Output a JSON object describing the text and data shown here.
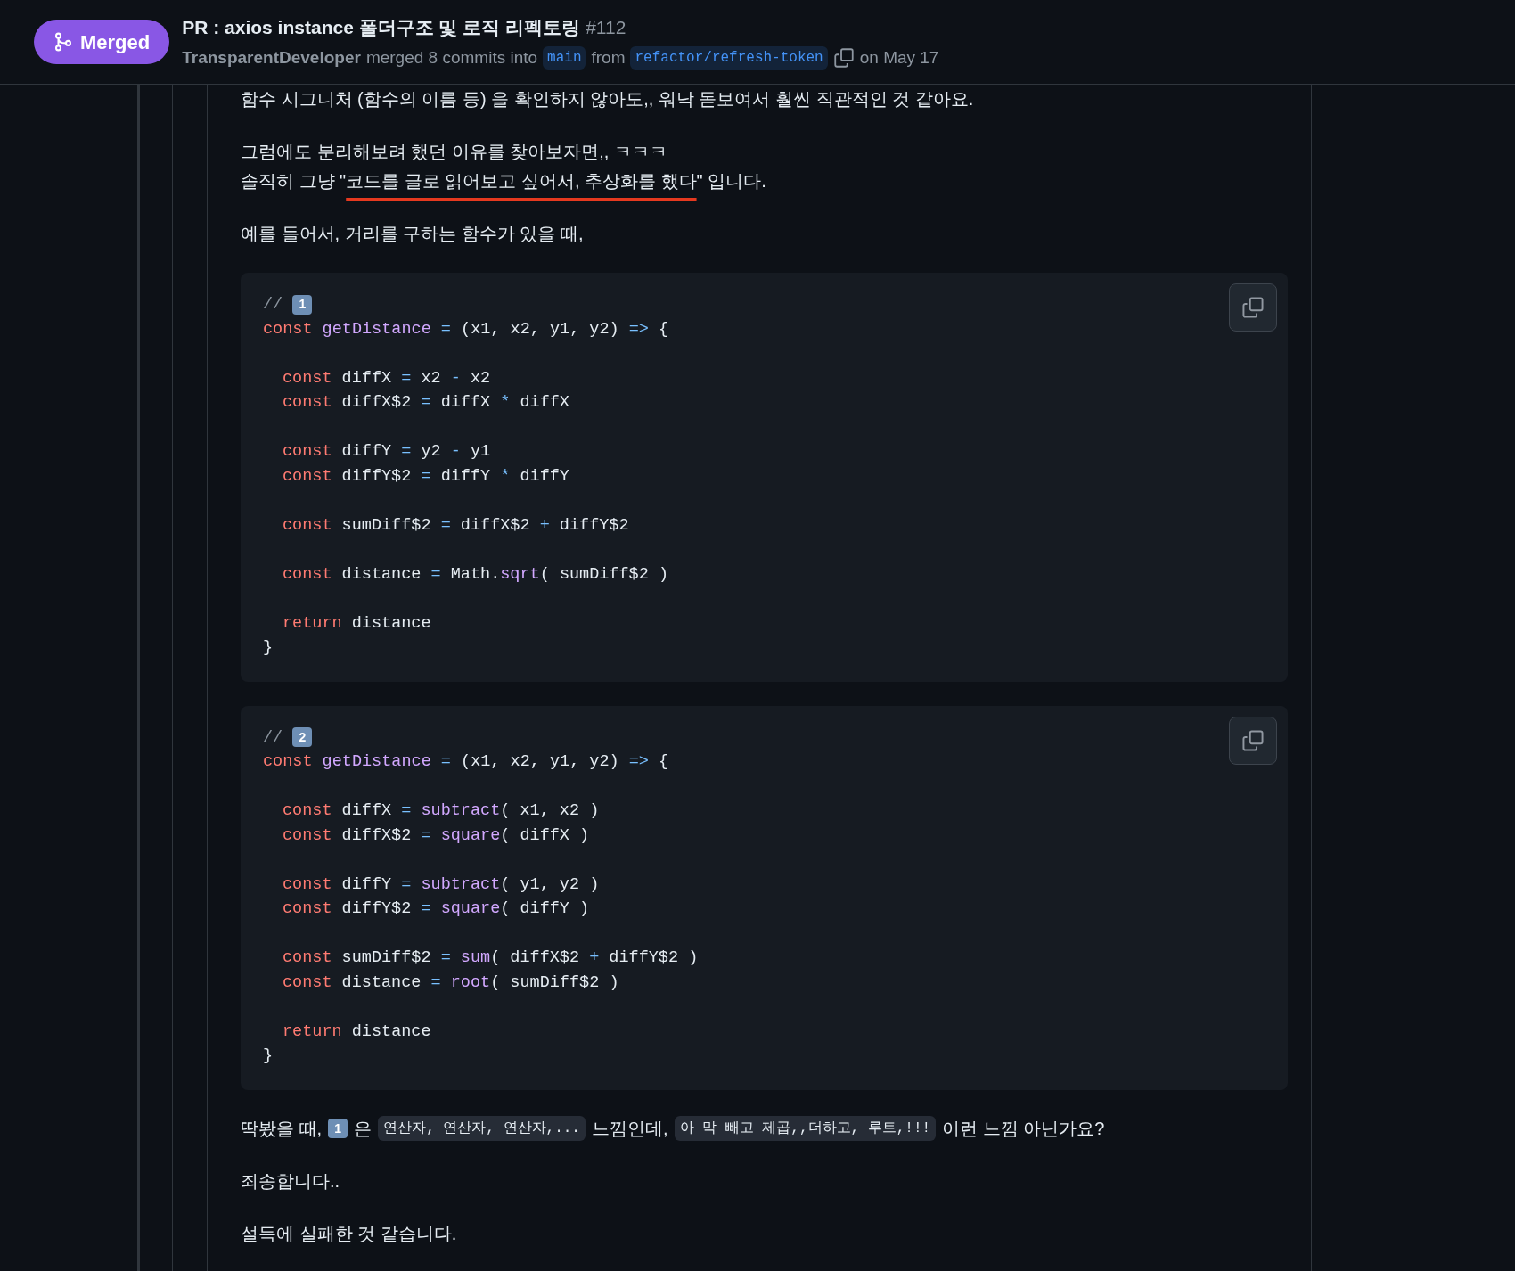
{
  "header": {
    "state_badge": "Merged",
    "title": "PR : axios instance 폴더구조 및 로직 리펙토링",
    "number": "#112",
    "author": "TransparentDeveloper",
    "action": "merged 8 commits into",
    "base_branch": "main",
    "from_word": "from",
    "head_branch": "refactor/refresh-token",
    "date": "on May 17"
  },
  "blocks": [
    {
      "kind": "paragraph",
      "lines": [
        [
          {
            "kind": "text",
            "text": "함수 시그니처 (함수의 이름 등) 을 확인하지 않아도,, 워낙 돋보여서 훨씬 직관적인 것 같아요."
          }
        ]
      ]
    },
    {
      "kind": "paragraph",
      "lines": [
        [
          {
            "kind": "text",
            "text": "그럼에도 분리해보려 했던 이유를 찾아보자면,, ㅋㅋㅋ"
          }
        ],
        [
          {
            "kind": "text",
            "text": "솔직히 그냥 \"**코드를 글로 읽어보고 싶어서, 추상화를 했다**\" 입니다.",
            "marked": true
          }
        ]
      ]
    },
    {
      "kind": "paragraph",
      "lines": [
        [
          {
            "kind": "text",
            "text": "예를 들어서, 거리를 구하는 함수가 있을 때,"
          }
        ]
      ]
    },
    {
      "kind": "code",
      "head": [
        {
          "tokens": [
            {
              "kind": "comment",
              "text": "//"
            },
            {
              "kind": "keycap",
              "text": "1"
            }
          ]
        },
        {
          "tokens": [
            {
              "kind": "keyword",
              "text": "const"
            },
            {
              "kind": "func",
              "text": "getDistance"
            },
            {
              "kind": "op",
              "text": "="
            },
            {
              "kind": "plain",
              "text": "(x1, x2, y1, y2)"
            },
            {
              "kind": "op",
              "text": "=>"
            },
            {
              "kind": "plain",
              "text": "{"
            }
          ]
        }
      ],
      "body": [
        [
          {
            "tokens": [
              {
                "kind": "keyword",
                "text": "const"
              },
              {
                "kind": "plain",
                "text": "diffX"
              },
              {
                "kind": "op",
                "text": "="
              },
              {
                "kind": "plain",
                "text": "x2"
              },
              {
                "kind": "op",
                "text": "-"
              },
              {
                "kind": "plain",
                "text": "x2"
              }
            ]
          },
          {
            "tokens": [
              {
                "kind": "keyword",
                "text": "const"
              },
              {
                "kind": "plain",
                "text": "diffX$2"
              },
              {
                "kind": "op",
                "text": "="
              },
              {
                "kind": "plain",
                "text": "diffX"
              },
              {
                "kind": "op",
                "text": "*"
              },
              {
                "kind": "plain",
                "text": "diffX"
              }
            ]
          }
        ],
        [
          {
            "tokens": [
              {
                "kind": "keyword",
                "text": "const"
              },
              {
                "kind": "plain",
                "text": "diffY"
              },
              {
                "kind": "op",
                "text": "="
              },
              {
                "kind": "plain",
                "text": "y2"
              },
              {
                "kind": "op",
                "text": "-"
              },
              {
                "kind": "plain",
                "text": "y1"
              }
            ]
          },
          {
            "tokens": [
              {
                "kind": "keyword",
                "text": "const"
              },
              {
                "kind": "plain",
                "text": "diffY$2"
              },
              {
                "kind": "op",
                "text": "="
              },
              {
                "kind": "plain",
                "text": "diffY"
              },
              {
                "kind": "op",
                "text": "*"
              },
              {
                "kind": "plain",
                "text": "diffY"
              }
            ]
          }
        ],
        [
          {
            "tokens": [
              {
                "kind": "keyword",
                "text": "const"
              },
              {
                "kind": "plain",
                "text": "sumDiff$2"
              },
              {
                "kind": "op",
                "text": "="
              },
              {
                "kind": "plain",
                "text": "diffX$2"
              },
              {
                "kind": "op",
                "text": "+"
              },
              {
                "kind": "plain",
                "text": "diffY$2"
              }
            ]
          }
        ],
        [
          {
            "tokens": [
              {
                "kind": "keyword",
                "text": "const"
              },
              {
                "kind": "plain",
                "text": "distance"
              },
              {
                "kind": "op",
                "text": "="
              },
              {
                "kind": "plain",
                "text": "Math."
              },
              {
                "kind": "func",
                "text": "sqrt"
              },
              {
                "kind": "plain",
                "text": "( sumDiff$2 )"
              }
            ]
          }
        ],
        [
          {
            "tokens": [
              {
                "kind": "keyword",
                "text": "return"
              },
              {
                "kind": "plain",
                "text": "distance"
              }
            ]
          }
        ]
      ],
      "tail": [
        {
          "tokens": [
            {
              "kind": "plain",
              "text": "}"
            }
          ]
        }
      ]
    },
    {
      "kind": "code",
      "head": [
        {
          "tokens": [
            {
              "kind": "comment",
              "text": "//"
            },
            {
              "kind": "keycap",
              "text": "2"
            }
          ]
        },
        {
          "tokens": [
            {
              "kind": "keyword",
              "text": "const"
            },
            {
              "kind": "func",
              "text": "getDistance"
            },
            {
              "kind": "op",
              "text": "="
            },
            {
              "kind": "plain",
              "text": "(x1, x2, y1, y2)"
            },
            {
              "kind": "op",
              "text": "=>"
            },
            {
              "kind": "plain",
              "text": "{"
            }
          ]
        }
      ],
      "body": [
        [
          {
            "tokens": [
              {
                "kind": "keyword",
                "text": "const"
              },
              {
                "kind": "plain",
                "text": "diffX"
              },
              {
                "kind": "op",
                "text": "="
              },
              {
                "kind": "func",
                "text": "subtract"
              },
              {
                "kind": "plain",
                "text": "( x1, x2 )"
              }
            ]
          },
          {
            "tokens": [
              {
                "kind": "keyword",
                "text": "const"
              },
              {
                "kind": "plain",
                "text": "diffX$2"
              },
              {
                "kind": "op",
                "text": "="
              },
              {
                "kind": "func",
                "text": "square"
              },
              {
                "kind": "plain",
                "text": "( diffX )"
              }
            ]
          }
        ],
        [
          {
            "tokens": [
              {
                "kind": "keyword",
                "text": "const"
              },
              {
                "kind": "plain",
                "text": "diffY"
              },
              {
                "kind": "op",
                "text": "="
              },
              {
                "kind": "func",
                "text": "subtract"
              },
              {
                "kind": "plain",
                "text": "( y1, y2 )"
              }
            ]
          },
          {
            "tokens": [
              {
                "kind": "keyword",
                "text": "const"
              },
              {
                "kind": "plain",
                "text": "diffY$2"
              },
              {
                "kind": "op",
                "text": "="
              },
              {
                "kind": "func",
                "text": "square"
              },
              {
                "kind": "plain",
                "text": "( diffY )"
              }
            ]
          }
        ],
        [
          {
            "tokens": [
              {
                "kind": "keyword",
                "text": "const"
              },
              {
                "kind": "plain",
                "text": "sumDiff$2"
              },
              {
                "kind": "op",
                "text": "="
              },
              {
                "kind": "func",
                "text": "sum"
              },
              {
                "kind": "plain",
                "text": "( diffX$2"
              },
              {
                "kind": "op",
                "text": "+"
              },
              {
                "kind": "plain",
                "text": "diffY$2 )"
              }
            ]
          },
          {
            "tokens": [
              {
                "kind": "keyword",
                "text": "const"
              },
              {
                "kind": "plain",
                "text": "distance"
              },
              {
                "kind": "op",
                "text": "="
              },
              {
                "kind": "func",
                "text": "root"
              },
              {
                "kind": "plain",
                "text": "( sumDiff$2 )"
              }
            ]
          }
        ],
        [
          {
            "tokens": [
              {
                "kind": "keyword",
                "text": "return"
              },
              {
                "kind": "plain",
                "text": "distance"
              }
            ]
          }
        ]
      ],
      "tail": [
        {
          "tokens": [
            {
              "kind": "plain",
              "text": "}"
            }
          ]
        }
      ]
    },
    {
      "kind": "paragraph",
      "lines": [
        [
          {
            "kind": "text",
            "text": "딱봤을 때,"
          },
          {
            "kind": "keycap",
            "text": "1"
          },
          {
            "kind": "text",
            "text": "은"
          },
          {
            "kind": "code",
            "text": "연산자, 연산자, 연산자,..."
          },
          {
            "kind": "text",
            "text": "느낌인데,"
          },
          {
            "kind": "code",
            "text": "아 막 빼고 제곱,,더하고, 루트,!!!"
          },
          {
            "kind": "text",
            "text": "이런 느낌 아닌가요?"
          }
        ]
      ]
    },
    {
      "kind": "paragraph",
      "lines": [
        [
          {
            "kind": "text",
            "text": "죄송합니다.."
          }
        ]
      ]
    },
    {
      "kind": "paragraph",
      "lines": [
        [
          {
            "kind": "text",
            "text": "설득에 실패한 것 같습니다."
          }
        ]
      ]
    }
  ]
}
